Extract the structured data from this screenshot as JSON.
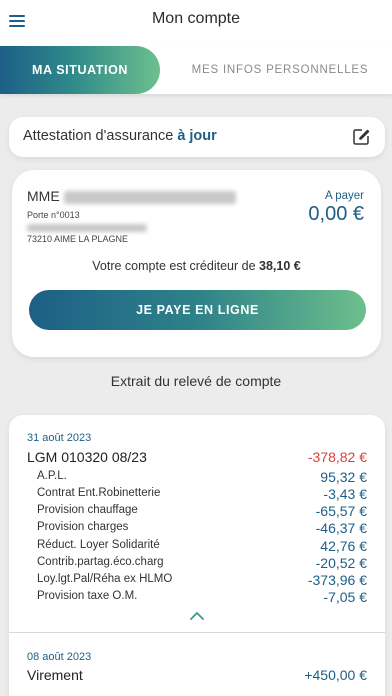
{
  "header": {
    "title": "Mon compte"
  },
  "tabs": [
    {
      "label": "MA SITUATION",
      "active": true
    },
    {
      "label": "MES INFOS PERSONNELLES",
      "active": false
    }
  ],
  "insurance": {
    "label": "Attestation d'assurance",
    "status": "à jour"
  },
  "account": {
    "name_prefix": "MME",
    "address_line": "Porte n°0013",
    "city": "73210 AIME LA PLAGNE",
    "due_label": "A payer",
    "due_amount": "0,00 €",
    "credit_prefix": "Votre compte est créditeur de",
    "credit_amount": "38,10 €",
    "pay_button": "JE PAYE EN LIGNE"
  },
  "statement": {
    "title": "Extrait du relevé de compte",
    "entries": [
      {
        "date": "31 août 2023",
        "label": "LGM 010320 08/23",
        "amount": "-378,82 €",
        "lines": [
          {
            "label": "A.P.L.",
            "amount": "95,32 €"
          },
          {
            "label": "Contrat Ent.Robinetterie",
            "amount": "-3,43 €"
          },
          {
            "label": "Provision chauffage",
            "amount": "-65,57 €"
          },
          {
            "label": "Provision charges",
            "amount": "-46,37 €"
          },
          {
            "label": "Réduct. Loyer Solidarité",
            "amount": "42,76 €"
          },
          {
            "label": "Contrib.partag.éco.charg",
            "amount": "-20,52 €"
          },
          {
            "label": "Loy.lgt.Pal/Réha ex HLMO",
            "amount": "-373,96 €"
          },
          {
            "label": "Provision taxe O.M.",
            "amount": "-7,05 €"
          }
        ]
      },
      {
        "date": "08 août 2023",
        "label": "Virement",
        "amount": "+450,00 €"
      }
    ]
  },
  "colors": {
    "primary": "#1d5f86",
    "accent": "#6dc08d",
    "negative": "#d9413a"
  },
  "icons": [
    "menu-icon",
    "edit-icon",
    "chevron-up-icon"
  ]
}
